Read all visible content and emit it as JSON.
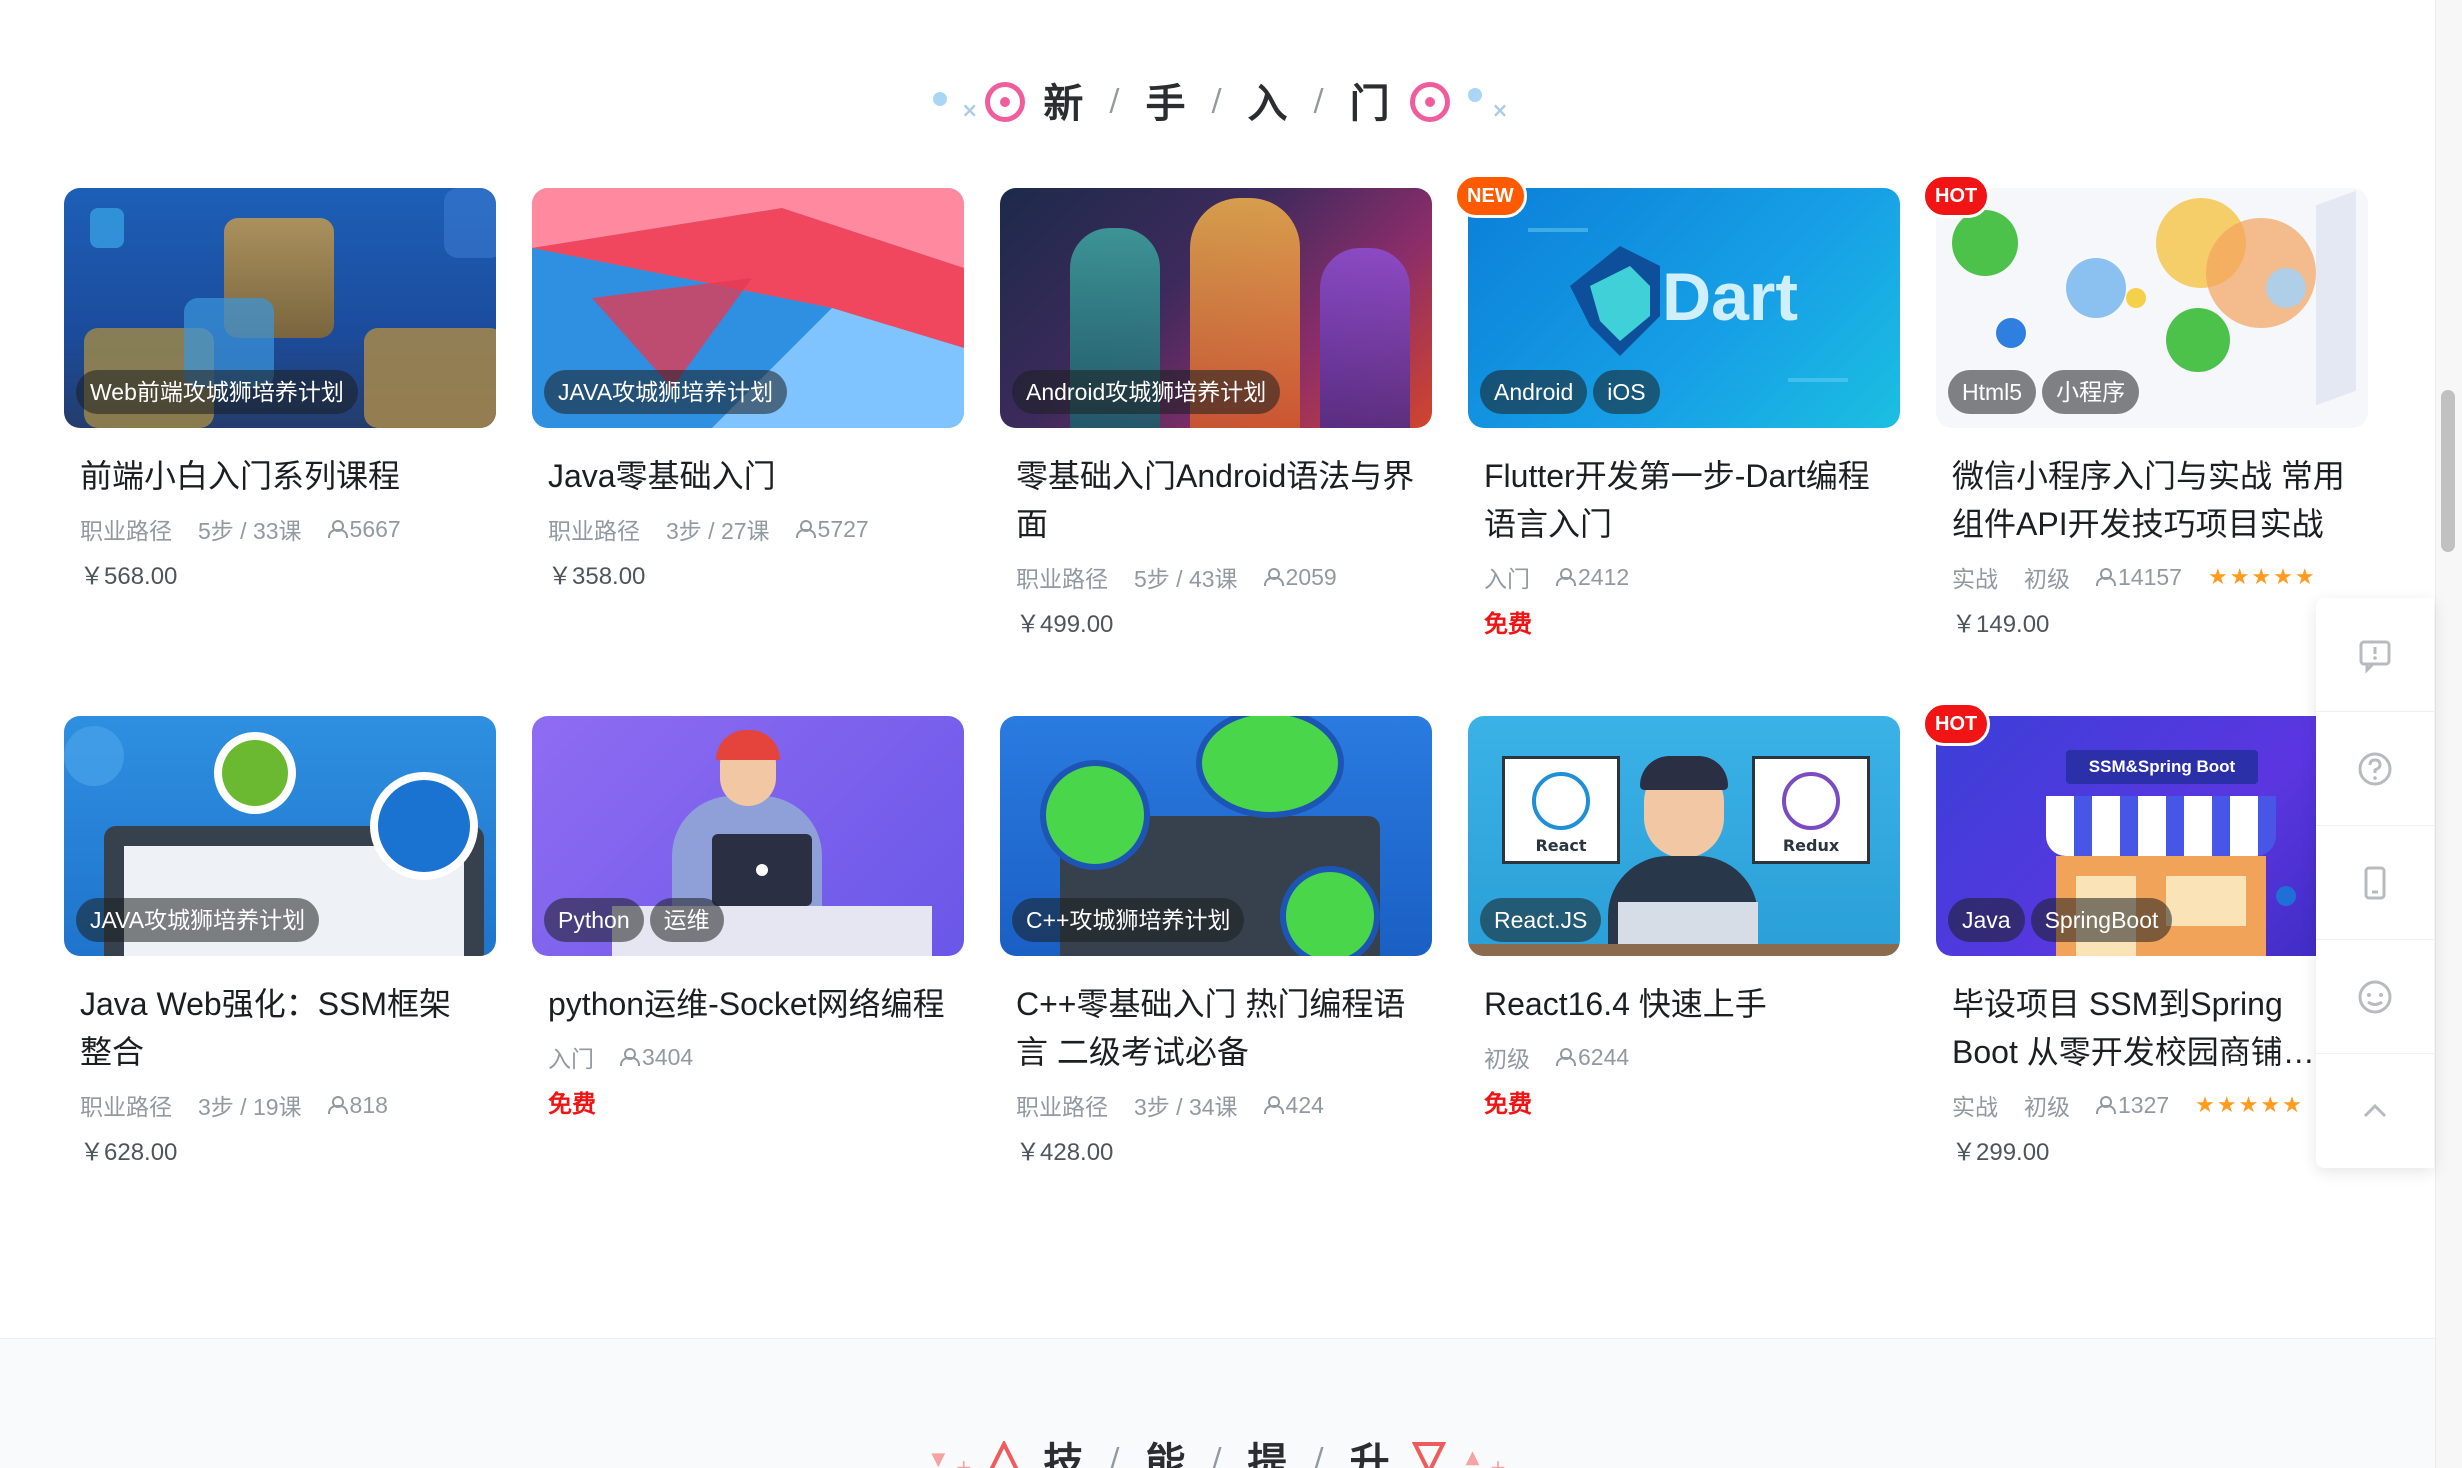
{
  "sections": {
    "beginner": {
      "title_chars": [
        "新",
        "手",
        "入",
        "门"
      ],
      "separator": "/"
    },
    "skills": {
      "title_chars": [
        "技",
        "能",
        "提",
        "升"
      ],
      "separator": "/"
    }
  },
  "cards": [
    {
      "title": "前端小白入门系列课程",
      "tags": [
        "Web前端攻城狮培养计划"
      ],
      "meta": [
        "职业路径",
        "5步 / 33课"
      ],
      "learners": "5667",
      "price": "￥568.00"
    },
    {
      "title": "Java零基础入门",
      "tags": [
        "JAVA攻城狮培养计划"
      ],
      "meta": [
        "职业路径",
        "3步 / 27课"
      ],
      "learners": "5727",
      "price": "￥358.00"
    },
    {
      "title": "零基础入门Android语法与界面",
      "tags": [
        "Android攻城狮培养计划"
      ],
      "meta": [
        "职业路径",
        "5步 / 43课"
      ],
      "learners": "2059",
      "price": "￥499.00"
    },
    {
      "title": "Flutter开发第一步-Dart编程语言入门",
      "tags": [
        "Android",
        "iOS"
      ],
      "meta": [
        "入门"
      ],
      "learners": "2412",
      "price": "免费",
      "badge": "NEW",
      "thumb_text": "Dart"
    },
    {
      "title": "微信小程序入门与实战 常用组件API开发技巧项目实战",
      "tags": [
        "Html5",
        "小程序"
      ],
      "meta": [
        "实战",
        "初级"
      ],
      "learners": "14157",
      "stars": "★★★★★",
      "price": "￥149.00",
      "badge": "HOT"
    },
    {
      "title": "Java Web强化：SSM框架整合",
      "tags": [
        "JAVA攻城狮培养计划"
      ],
      "meta": [
        "职业路径",
        "3步 / 19课"
      ],
      "learners": "818",
      "price": "￥628.00"
    },
    {
      "title": "python运维-Socket网络编程",
      "tags": [
        "Python",
        "运维"
      ],
      "meta": [
        "入门"
      ],
      "learners": "3404",
      "price": "免费"
    },
    {
      "title": "C++零基础入门 热门编程语言 二级考试必备",
      "tags": [
        "C++攻城狮培养计划"
      ],
      "meta": [
        "职业路径",
        "3步 / 34课"
      ],
      "learners": "424",
      "price": "￥428.00"
    },
    {
      "title": "React16.4 快速上手",
      "tags": [
        "React.JS"
      ],
      "meta": [
        "初级"
      ],
      "learners": "6244",
      "price": "免费",
      "thumb_labels": [
        "React",
        "Redux"
      ]
    },
    {
      "title": "毕设项目 SSM到Spring Boot 从零开发校园商铺…",
      "tags": [
        "Java",
        "SpringBoot"
      ],
      "meta": [
        "实战",
        "初级"
      ],
      "learners": "1327",
      "stars": "★★★★★",
      "price": "￥299.00",
      "badge": "HOT",
      "thumb_text": "SSM&Spring Boot"
    }
  ],
  "side_toolbar": [
    "feedback-icon",
    "help-icon",
    "mobile-app-icon",
    "customer-service-icon",
    "back-to-top-icon"
  ],
  "colors": {
    "accent_pink": "#f05d9d",
    "price_free": "#f01414",
    "badge_hot": "#f01414",
    "badge_new": "#ff5a00",
    "star": "#ff9b1f"
  }
}
